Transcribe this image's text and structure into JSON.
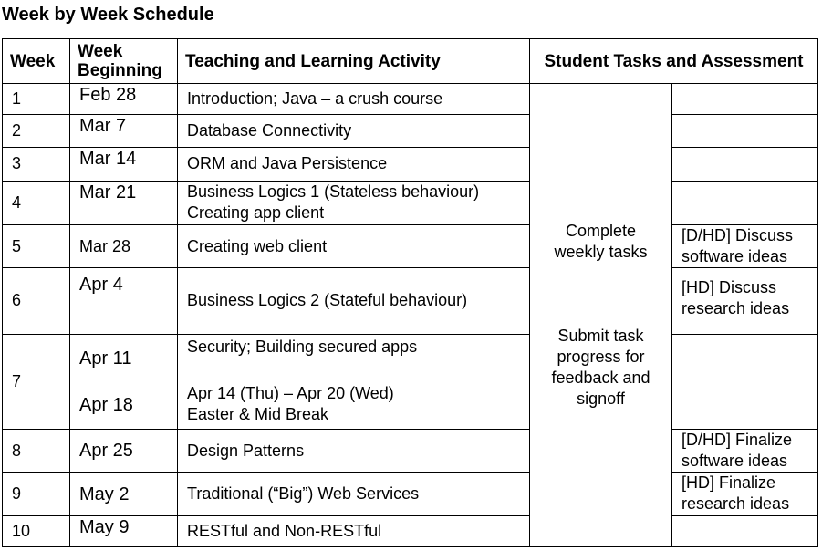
{
  "title": "Week by Week Schedule",
  "headers": {
    "week": "Week",
    "week_beginning_1": "Week",
    "week_beginning_2": "Beginning",
    "activity": "Teaching and Learning Activity",
    "student": "Student Tasks and Assessment"
  },
  "rows": [
    {
      "week": "1",
      "date": "Feb 28",
      "activity": "Introduction; Java – a crush course",
      "assessment": ""
    },
    {
      "week": "2",
      "date": "Mar 7",
      "activity": "Database Connectivity",
      "assessment": ""
    },
    {
      "week": "3",
      "date": "Mar 14",
      "activity": "ORM and Java Persistence",
      "assessment": ""
    },
    {
      "week": "4",
      "date": "Mar 21",
      "activity": "Business Logics 1 (Stateless behaviour)",
      "activity2": "Creating app client",
      "assessment": ""
    },
    {
      "week": "5",
      "date": "Mar 28",
      "activity": "Creating web client",
      "assessment": "[D/HD] Discuss",
      "assessment2": "software ideas"
    },
    {
      "week": "6",
      "date": "Apr 4",
      "activity": "Business Logics 2 (Stateful behaviour)",
      "assessment": "[HD] Discuss",
      "assessment2": "research ideas"
    },
    {
      "week": "7",
      "date": "Apr 11",
      "date2": "Apr 18",
      "activity": "Security; Building secured apps",
      "activity2": "Apr 14 (Thu) – Apr 20 (Wed)",
      "activity3": "Easter & Mid Break",
      "assessment": ""
    },
    {
      "week": "8",
      "date": "Apr 25",
      "activity": "Design Patterns",
      "assessment": "[D/HD] Finalize",
      "assessment2": "software ideas"
    },
    {
      "week": "9",
      "date": "May 2",
      "activity": "Traditional (“Big”) Web Services",
      "assessment": "[HD] Finalize",
      "assessment2": "research ideas"
    },
    {
      "week": "10",
      "date": "May 9",
      "activity": "RESTful and Non-RESTful",
      "assessment": ""
    }
  ],
  "student_tasks": {
    "block1_line1": "Complete",
    "block1_line2": "weekly tasks",
    "block2_line1": "Submit task",
    "block2_line2": "progress for",
    "block2_line3": "feedback and",
    "block2_line4": "signoff"
  }
}
